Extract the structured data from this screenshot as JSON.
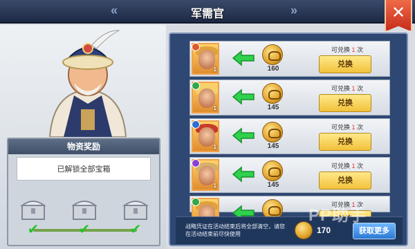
{
  "header": {
    "title": "军需官",
    "close_icon": "close-icon"
  },
  "reward_panel": {
    "title": "物资奖励",
    "status_text": "已解锁全部宝箱",
    "chests": [
      {
        "icon": "treasure-chest-icon",
        "checked": true
      },
      {
        "icon": "treasure-chest-icon",
        "checked": true
      },
      {
        "icon": "treasure-chest-icon",
        "checked": true
      }
    ]
  },
  "exchange_list": [
    {
      "cost": "160",
      "label_prefix": "可兑换",
      "count": "1",
      "label_suffix": "次",
      "button": "兑换",
      "level": "1",
      "hair": "#e0a23c",
      "faction": "#e05a2a"
    },
    {
      "cost": "145",
      "label_prefix": "可兑换",
      "count": "1",
      "label_suffix": "次",
      "button": "兑换",
      "level": "1",
      "hair": "#f2d36b",
      "faction": "#2fa84a"
    },
    {
      "cost": "145",
      "label_prefix": "可兑换",
      "count": "1",
      "label_suffix": "次",
      "button": "兑换",
      "level": "1",
      "hair": "#c83a2a",
      "faction": "#2a6fd6"
    },
    {
      "cost": "145",
      "label_prefix": "可兑换",
      "count": "1",
      "label_suffix": "次",
      "button": "兑换",
      "level": "1",
      "hair": "#d6b06a",
      "faction": "#8b3fd6"
    },
    {
      "cost": "",
      "label_prefix": "可兑换",
      "count": "1",
      "label_suffix": "次",
      "button": "兑换",
      "level": "",
      "hair": "#e0a23c",
      "faction": "#2fa84a"
    }
  ],
  "bottom": {
    "note": "战略凭证在活动结束后将全部清空，请您在活动结束前尽快使用",
    "balance": "170",
    "get_more": "获取更多"
  },
  "watermark": "PP助手",
  "colors": {
    "accent": "#f2c13b",
    "panel": "#2f4873",
    "check": "#27c22b"
  }
}
